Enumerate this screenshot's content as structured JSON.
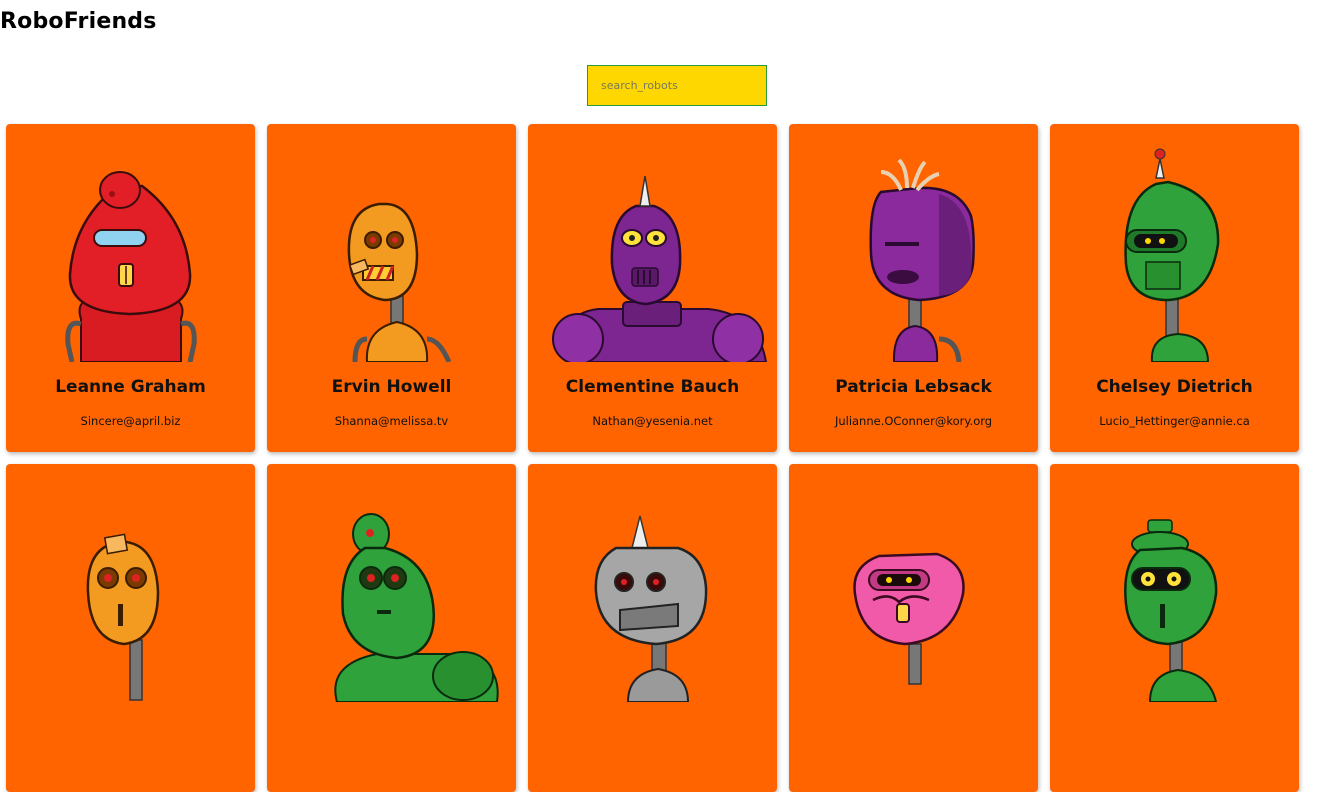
{
  "app": {
    "title": "RoboFriends"
  },
  "search": {
    "placeholder": "search_robots",
    "value": ""
  },
  "colors": {
    "card": "#ff6400",
    "search_bg": "#ffd700",
    "search_border": "#2a9a3a"
  },
  "robots": [
    {
      "name": "Leanne Graham",
      "email": "Sincere@april.biz",
      "robot_color": "#e21f26",
      "icon": "red-robot-icon"
    },
    {
      "name": "Ervin Howell",
      "email": "Shanna@melissa.tv",
      "robot_color": "#f39a20",
      "icon": "orange-robot-icon"
    },
    {
      "name": "Clementine Bauch",
      "email": "Nathan@yesenia.net",
      "robot_color": "#7d2590",
      "icon": "purple-robot-icon"
    },
    {
      "name": "Patricia Lebsack",
      "email": "Julianne.OConner@kory.org",
      "robot_color": "#8a2a9c",
      "icon": "purple-robot-icon"
    },
    {
      "name": "Chelsey Dietrich",
      "email": "Lucio_Hettinger@annie.ca",
      "robot_color": "#2fa23c",
      "icon": "green-robot-icon"
    },
    {
      "name": "",
      "email": "",
      "robot_color": "#f39a20",
      "icon": "orange-robot-icon"
    },
    {
      "name": "",
      "email": "",
      "robot_color": "#2fa23c",
      "icon": "green-robot-icon"
    },
    {
      "name": "",
      "email": "",
      "robot_color": "#9a9a9a",
      "icon": "gray-robot-icon"
    },
    {
      "name": "",
      "email": "",
      "robot_color": "#f05aa8",
      "icon": "pink-robot-icon"
    },
    {
      "name": "",
      "email": "",
      "robot_color": "#2fa23c",
      "icon": "green-robot-icon"
    }
  ]
}
